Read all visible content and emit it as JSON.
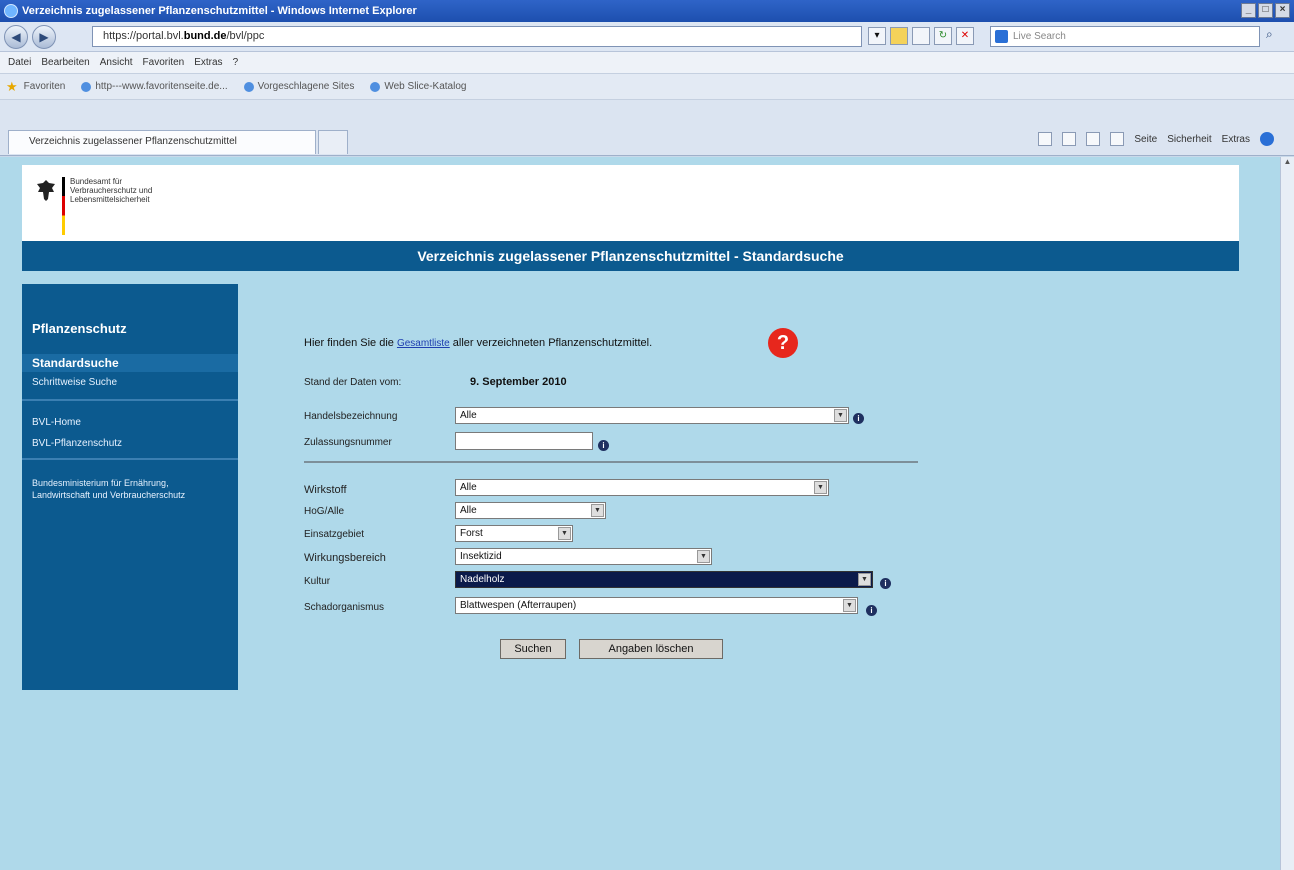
{
  "browser": {
    "window_title": "Verzeichnis zugelassener Pflanzenschutzmittel - Windows Internet Explorer",
    "url_prefix": "https://portal.bvl.",
    "url_domain": "bund.de",
    "url_suffix": "/bvl/ppc",
    "search_placeholder": "Live Search",
    "menu": [
      "Datei",
      "Bearbeiten",
      "Ansicht",
      "Favoriten",
      "Extras",
      "?"
    ],
    "favorites_label": "Favoriten",
    "favorites_links": [
      "http---www.favoritenseite.de...",
      "Vorgeschlagene Sites",
      "Web Slice-Katalog"
    ],
    "tab_title": "Verzeichnis zugelassener Pflanzenschutzmittel",
    "command_bar": [
      "Seite",
      "Sicherheit",
      "Extras"
    ]
  },
  "org": {
    "name_line1": "Bundesamt für",
    "name_line2": "Verbraucherschutz und",
    "name_line3": "Lebensmittelsicherheit"
  },
  "page_title": "Verzeichnis zugelassener Pflanzenschutzmittel - Standardsuche",
  "sidebar": {
    "heading": "Pflanzenschutz",
    "items": [
      {
        "label": "Standardsuche",
        "active": true
      },
      {
        "label": "Schrittweise Suche",
        "active": false
      },
      {
        "label": "BVL-Home",
        "active": false
      },
      {
        "label": "BVL-Pflanzenschutz",
        "active": false
      },
      {
        "label": "Bundesministerium für Ernährung, Landwirtschaft und Verbraucherschutz",
        "active": false
      }
    ]
  },
  "form": {
    "intro_before": "Hier finden Sie die ",
    "intro_link": "Gesamtliste",
    "intro_after": " aller verzeichneten Pflanzenschutzmittel.",
    "stand_label": "Stand der Daten vom:",
    "stand_value": "9. September 2010",
    "fields": {
      "handelsbezeichnung": {
        "label": "Handelsbezeichnung",
        "value": "Alle"
      },
      "zulassungsnummer": {
        "label": "Zulassungsnummer",
        "value": ""
      },
      "wirkstoff": {
        "label": "Wirkstoff",
        "value": "Alle"
      },
      "hoe_alle": {
        "label": "HoG/Alle",
        "value": "Alle"
      },
      "einsatzgebiet": {
        "label": "Einsatzgebiet",
        "value": "Forst"
      },
      "wirkungsbereich": {
        "label": "Wirkungsbereich",
        "value": "Insektizid"
      },
      "kultur": {
        "label": "Kultur",
        "value": "Nadelholz"
      },
      "schadorganismus": {
        "label": "Schadorganismus",
        "value": "Blattwespen (Afterraupen)"
      }
    },
    "search_button": "Suchen",
    "clear_button": "Angaben löschen",
    "info_glyph": "i",
    "help_glyph": "?"
  },
  "colors": {
    "page_bg": "#afd9ea",
    "nav_blue": "#0c5a8f",
    "help_red": "#e7271d"
  }
}
